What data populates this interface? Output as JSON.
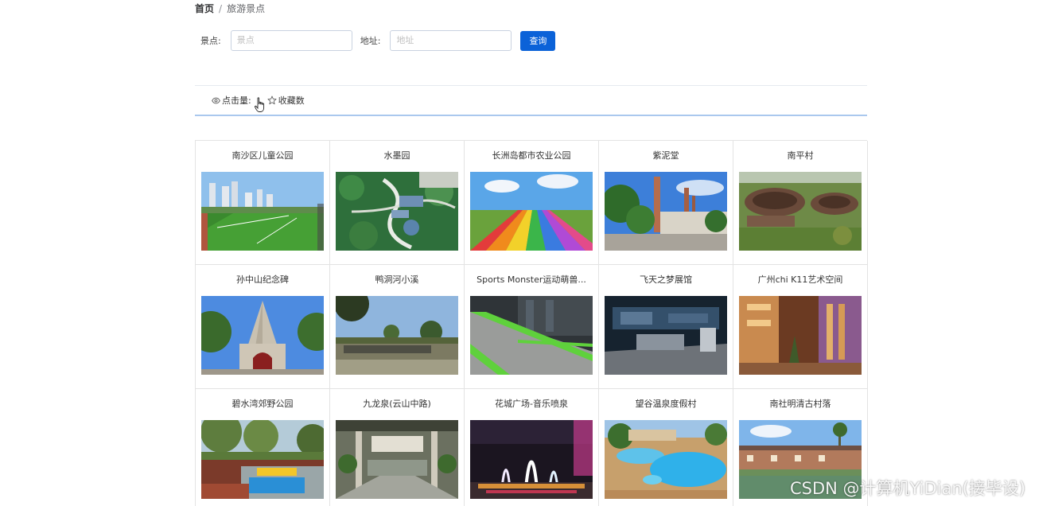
{
  "breadcrumb": {
    "home": "首页",
    "separator": "/",
    "current": "旅游景点"
  },
  "search": {
    "spot_label": "景点:",
    "spot_placeholder": "景点",
    "spot_value": "",
    "address_label": "地址:",
    "address_placeholder": "地址",
    "address_value": "",
    "button_label": "查询"
  },
  "sort": {
    "clicks": {
      "icon": "eye-icon",
      "label": "点击量:"
    },
    "favorites": {
      "icon": "star-icon",
      "label": "收藏数"
    }
  },
  "spots": [
    {
      "name": "南沙区儿童公园"
    },
    {
      "name": "水墨园"
    },
    {
      "name": "长洲岛都市农业公园"
    },
    {
      "name": "紫泥堂"
    },
    {
      "name": "南平村"
    },
    {
      "name": "孙中山纪念碑"
    },
    {
      "name": "鸭洞河小溪"
    },
    {
      "name": "Sports Monster运动萌兽..."
    },
    {
      "name": "飞天之梦展馆"
    },
    {
      "name": "广州chi K11艺术空间"
    },
    {
      "name": "碧水湾郊野公园"
    },
    {
      "name": "九龙泉(云山中路)"
    },
    {
      "name": "花城广场-音乐喷泉"
    },
    {
      "name": "望谷温泉度假村"
    },
    {
      "name": "南社明清古村落"
    }
  ],
  "watermark": "CSDN @计算机YiDian(接毕设)"
}
